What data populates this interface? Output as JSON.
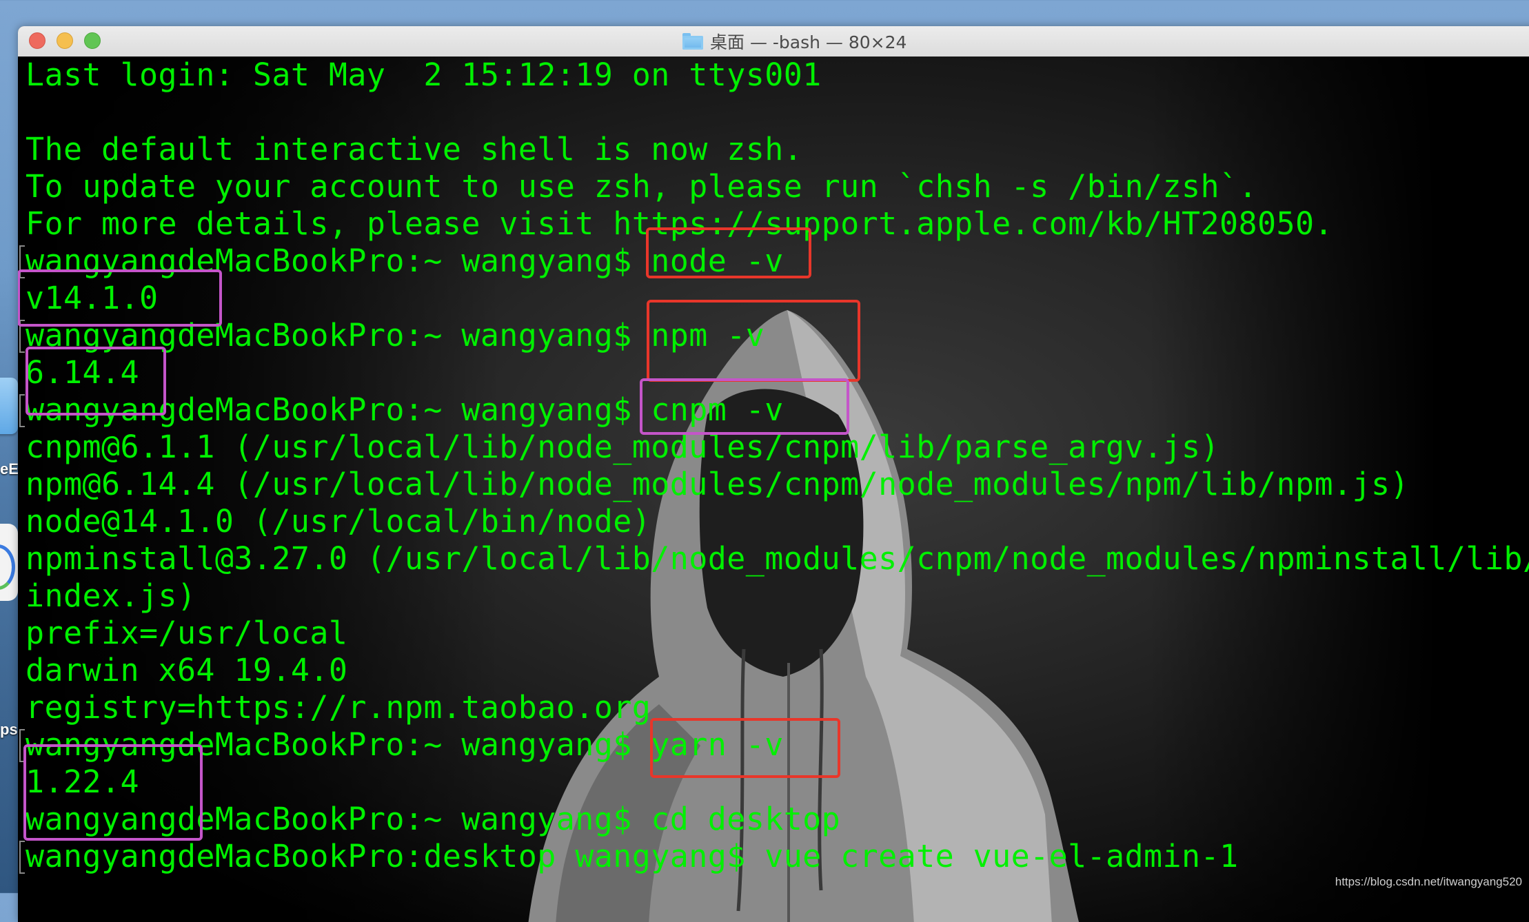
{
  "window": {
    "title": "桌面 — -bash — 80×24",
    "folder_icon": "folder-icon",
    "traffic_lights": [
      "close",
      "minimize",
      "zoom"
    ]
  },
  "desktop": {
    "icon_labels": [
      "eE",
      "ps"
    ]
  },
  "terminal": {
    "text_color": "#00f000",
    "lines": [
      "Last login: Sat May  2 15:12:19 on ttys001",
      "",
      "The default interactive shell is now zsh.",
      "To update your account to use zsh, please run `chsh -s /bin/zsh`.",
      "For more details, please visit https://support.apple.com/kb/HT208050.",
      "wangyangdeMacBookPro:~ wangyang$ node -v",
      "v14.1.0",
      "wangyangdeMacBookPro:~ wangyang$ npm -v",
      "6.14.4",
      "wangyangdeMacBookPro:~ wangyang$ cnpm -v",
      "cnpm@6.1.1 (/usr/local/lib/node_modules/cnpm/lib/parse_argv.js)",
      "npm@6.14.4 (/usr/local/lib/node_modules/cnpm/node_modules/npm/lib/npm.js)",
      "node@14.1.0 (/usr/local/bin/node)",
      "npminstall@3.27.0 (/usr/local/lib/node_modules/cnpm/node_modules/npminstall/lib/",
      "index.js)",
      "prefix=/usr/local",
      "darwin x64 19.4.0",
      "registry=https://r.npm.taobao.org",
      "wangyangdeMacBookPro:~ wangyang$ yarn -v",
      "1.22.4",
      "wangyangdeMacBookPro:~ wangyang$ cd desktop",
      "wangyangdeMacBookPro:desktop wangyang$ vue create vue-el-admin-1"
    ]
  },
  "annotations": {
    "colors": {
      "red": "#e8362a",
      "purple": "#c455c9"
    },
    "boxes": [
      {
        "color": "red",
        "target": "node -v"
      },
      {
        "color": "purple",
        "target": "v14.1.0"
      },
      {
        "color": "red",
        "target": "npm -v"
      },
      {
        "color": "purple",
        "target": "6.14.4"
      },
      {
        "color": "purple",
        "target": "cnpm -v"
      },
      {
        "color": "red",
        "target": "yarn -v"
      },
      {
        "color": "purple",
        "target": "1.22.4"
      }
    ]
  },
  "watermark": "https://blog.csdn.net/itwangyang520"
}
